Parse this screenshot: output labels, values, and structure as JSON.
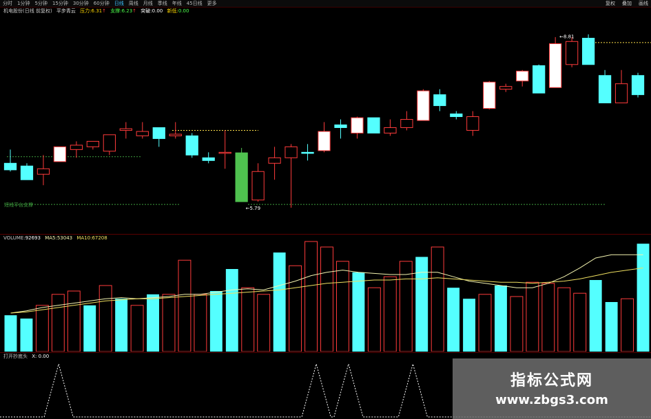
{
  "toolbar": {
    "periods": [
      "分时",
      "1分钟",
      "5分钟",
      "15分钟",
      "30分钟",
      "60分钟",
      "日线",
      "周线",
      "月线",
      "季线",
      "年线",
      "45日线",
      "更多"
    ],
    "active_period": "日线",
    "right_items": [
      "复权",
      "叠加",
      "画线"
    ]
  },
  "main_legend": {
    "title": "机电股份(日线 前复权)",
    "indicator": "平步青云",
    "pressure_label": "压力:",
    "pressure_value": "6.31",
    "support_label": "支撑:",
    "support_value": "6.23",
    "breakout_label": "突破:",
    "breakout_value": "0.00",
    "low_label": "新低:",
    "low_value": "0.00"
  },
  "main_labels": {
    "high_label": "8.81",
    "low_label": "5.79",
    "mid_note": "短线平台支撑"
  },
  "volume_legend": {
    "label": "VOLUME:",
    "value": "92693",
    "ma5_label": "MA5:",
    "ma5_value": "53043",
    "ma10_label": "MA10:",
    "ma10_value": "67208"
  },
  "signal_legend": {
    "label": "打开抄底头",
    "value": "X: 0.00"
  },
  "watermark": {
    "line1": "指标公式网",
    "line2": "www.zbgs3.com"
  },
  "colors": {
    "up": "#ff3b3b",
    "down": "#54ffff",
    "limit_up": "#4fc14f",
    "ma5": "#f4f4b0",
    "ma10": "#f0e060",
    "background": "#000000"
  },
  "chart_data": [
    {
      "type": "candlestick",
      "ylim": [
        5.5,
        9.2
      ],
      "candles": [
        {
          "o": 6.6,
          "h": 6.85,
          "l": 6.45,
          "c": 6.48
        },
        {
          "o": 6.55,
          "h": 6.6,
          "l": 6.3,
          "c": 6.3
        },
        {
          "o": 6.4,
          "h": 6.75,
          "l": 6.2,
          "c": 6.5
        },
        {
          "o": 6.63,
          "h": 6.9,
          "l": 6.63,
          "c": 6.9
        },
        {
          "o": 6.85,
          "h": 7.0,
          "l": 6.7,
          "c": 6.93
        },
        {
          "o": 6.9,
          "h": 7.0,
          "l": 6.85,
          "c": 7.0
        },
        {
          "o": 6.82,
          "h": 7.12,
          "l": 6.75,
          "c": 7.12
        },
        {
          "o": 7.2,
          "h": 7.35,
          "l": 7.05,
          "c": 7.23
        },
        {
          "o": 7.1,
          "h": 7.35,
          "l": 7.05,
          "c": 7.18
        },
        {
          "o": 7.25,
          "h": 7.25,
          "l": 6.9,
          "c": 7.05
        },
        {
          "o": 7.1,
          "h": 7.35,
          "l": 7.05,
          "c": 7.13
        },
        {
          "o": 7.1,
          "h": 7.15,
          "l": 6.7,
          "c": 6.75
        },
        {
          "o": 6.7,
          "h": 6.8,
          "l": 6.6,
          "c": 6.65
        },
        {
          "o": 6.8,
          "h": 7.2,
          "l": 6.5,
          "c": 6.8
        },
        {
          "o": 6.79,
          "h": 6.88,
          "l": 5.9,
          "c": 5.9
        },
        {
          "o": 5.93,
          "h": 6.6,
          "l": 5.9,
          "c": 6.45
        },
        {
          "o": 6.6,
          "h": 6.9,
          "l": 6.3,
          "c": 6.7
        },
        {
          "o": 6.7,
          "h": 6.95,
          "l": 5.79,
          "c": 6.9
        },
        {
          "o": 6.8,
          "h": 6.95,
          "l": 6.65,
          "c": 6.78
        },
        {
          "o": 6.83,
          "h": 7.35,
          "l": 6.8,
          "c": 7.18
        },
        {
          "o": 7.3,
          "h": 7.4,
          "l": 7.05,
          "c": 7.25
        },
        {
          "o": 7.15,
          "h": 7.45,
          "l": 7.05,
          "c": 7.43
        },
        {
          "o": 7.43,
          "h": 7.43,
          "l": 7.15,
          "c": 7.15
        },
        {
          "o": 7.15,
          "h": 7.4,
          "l": 7.1,
          "c": 7.25
        },
        {
          "o": 7.25,
          "h": 7.55,
          "l": 7.2,
          "c": 7.4
        },
        {
          "o": 7.38,
          "h": 7.95,
          "l": 7.38,
          "c": 7.92
        },
        {
          "o": 7.85,
          "h": 7.95,
          "l": 7.55,
          "c": 7.65
        },
        {
          "o": 7.5,
          "h": 7.55,
          "l": 7.4,
          "c": 7.45
        },
        {
          "o": 7.2,
          "h": 7.55,
          "l": 7.1,
          "c": 7.45
        },
        {
          "o": 7.6,
          "h": 8.1,
          "l": 7.58,
          "c": 8.08
        },
        {
          "o": 7.95,
          "h": 8.05,
          "l": 7.9,
          "c": 8.0
        },
        {
          "o": 8.1,
          "h": 8.3,
          "l": 8.0,
          "c": 8.28
        },
        {
          "o": 8.38,
          "h": 8.4,
          "l": 7.88,
          "c": 7.88
        },
        {
          "o": 7.98,
          "h": 8.9,
          "l": 7.98,
          "c": 8.78
        },
        {
          "o": 8.4,
          "h": 8.9,
          "l": 8.35,
          "c": 8.82
        },
        {
          "o": 8.88,
          "h": 8.95,
          "l": 8.4,
          "c": 8.4
        },
        {
          "o": 8.2,
          "h": 8.3,
          "l": 7.7,
          "c": 7.7
        },
        {
          "o": 7.7,
          "h": 8.3,
          "l": 7.7,
          "c": 8.05
        },
        {
          "o": 8.2,
          "h": 8.25,
          "l": 7.8,
          "c": 7.85
        }
      ],
      "support_lines": [
        6.72,
        5.85
      ],
      "pressure_line": 7.2,
      "high_line": 8.8
    },
    {
      "type": "bar",
      "series": [
        {
          "name": "VOLUME",
          "values": [
            33,
            30,
            42,
            52,
            55,
            42,
            60,
            48,
            42,
            52,
            52,
            83,
            52,
            55,
            75,
            58,
            52,
            90,
            78,
            100,
            95,
            82,
            72,
            58,
            68,
            82,
            86,
            95,
            58,
            48,
            52,
            60,
            50,
            63,
            62,
            58,
            53,
            65,
            45,
            48,
            98
          ]
        }
      ],
      "ma5": [
        35,
        37,
        40,
        42,
        44,
        46,
        48,
        49,
        48,
        49,
        50,
        52,
        52,
        54,
        56,
        57,
        56,
        60,
        64,
        69,
        72,
        74,
        72,
        71,
        70,
        70,
        72,
        72,
        68,
        64,
        62,
        60,
        58,
        58,
        62,
        68,
        76,
        85,
        88,
        88,
        88
      ],
      "ma10": [
        35,
        36,
        38,
        40,
        42,
        44,
        46,
        47,
        48,
        48,
        49,
        50,
        51,
        52,
        53,
        54,
        55,
        56,
        58,
        60,
        62,
        63,
        64,
        65,
        65,
        66,
        66,
        67,
        66,
        65,
        64,
        63,
        63,
        62,
        63,
        64,
        66,
        69,
        72,
        74,
        76
      ]
    },
    {
      "type": "line",
      "values": [
        0,
        0,
        0,
        0,
        0,
        0,
        0,
        0,
        0,
        0,
        0,
        0,
        0,
        0,
        0,
        0,
        0,
        0,
        0,
        0,
        0,
        0,
        0,
        0,
        0,
        0,
        0,
        0,
        0,
        0,
        0,
        0,
        0,
        0,
        0,
        0,
        0,
        0,
        0,
        0
      ],
      "spikes": [
        3,
        19,
        21,
        25
      ]
    }
  ]
}
